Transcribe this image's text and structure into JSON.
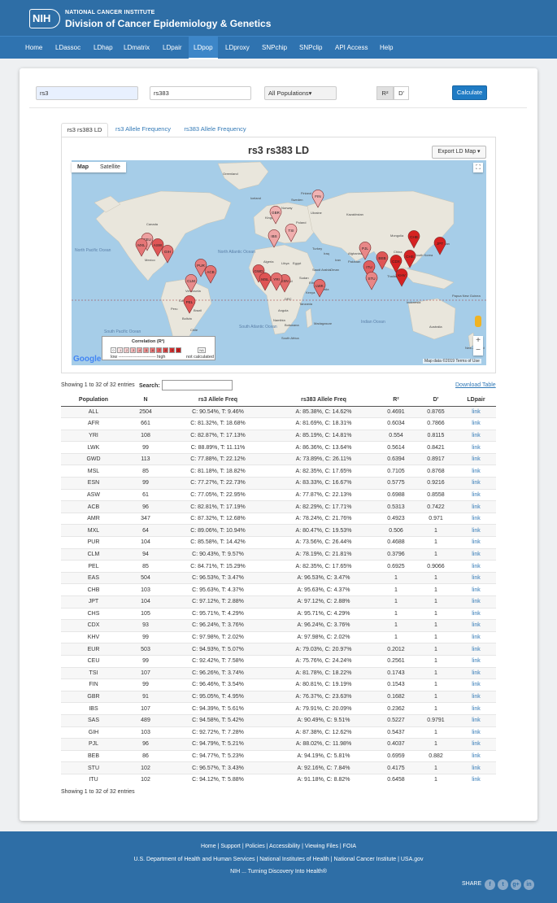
{
  "header": {
    "logo": "NIH",
    "org_line1": "NATIONAL CANCER INSTITUTE",
    "org_line2": "Division of Cancer Epidemiology & Genetics"
  },
  "nav": [
    "Home",
    "LDassoc",
    "LDhap",
    "LDmatrix",
    "LDpair",
    "LDpop",
    "LDproxy",
    "SNPchip",
    "SNPclip",
    "API Access",
    "Help"
  ],
  "form": {
    "snp1": "rs3",
    "snp2": "rs383",
    "population": "All Populations▾",
    "r2": "R²",
    "d": "D'",
    "calculate": "Calculate"
  },
  "tabs": [
    "rs3 rs383 LD",
    "rs3 Allele Frequency",
    "rs383 Allele Frequency"
  ],
  "map": {
    "title": "rs3 rs383 LD",
    "export": "Export LD Map ▾",
    "type_map": "Map",
    "type_satellite": "Satellite",
    "google": "Google",
    "attribution": "Map data ©2019   Terms of Use",
    "legend_title": "Correlation (R²)",
    "legend_low": "low ------------------------- high",
    "legend_na": "NA",
    "legend_nc": "not calculated",
    "legend_cells": [
      "0",
      ".1",
      ".2",
      ".3",
      ".4",
      ".5",
      ".6",
      ".7",
      ".8",
      ".9",
      "1"
    ],
    "place_labels": [
      "Greenland",
      "Iceland",
      "Sweden",
      "Norway",
      "Finland",
      "Ukraine",
      "Kazakhstan",
      "Mongolia",
      "China",
      "South Korea",
      "Japan",
      "Turkey",
      "Iran",
      "Afghanistan",
      "Pakistan",
      "India",
      "Thailand",
      "Egypt",
      "Saudi Arabia",
      "Algeria",
      "Libya",
      "Sudan",
      "Chad",
      "Mali",
      "Niger",
      "DRC",
      "Tanzania",
      "Angola",
      "Namibia",
      "Botswana",
      "Madagascar",
      "South Africa",
      "Indonesia",
      "Papua New Guinea",
      "Australia",
      "New Zealand",
      "Canada",
      "United States",
      "Mexico",
      "Colombia",
      "Peru",
      "Brazil",
      "Bolivia",
      "Chile",
      "Argentina",
      "Venezuela",
      "Poland",
      "Iraq",
      "Kenya",
      "Ethiopia",
      "Somalia",
      "Oman",
      "Kingdom"
    ],
    "ocean_labels": [
      "North Pacific Ocean",
      "North Atlantic Ocean",
      "South Pacific Ocean",
      "South Atlantic Ocean",
      "Indian Ocean"
    ],
    "markers": [
      "FIN",
      "GBR",
      "TSI",
      "IBS",
      "CEU",
      "ASW",
      "MXL",
      "GIH",
      "PUR",
      "ACB",
      "CLM",
      "PEL",
      "GWD",
      "MSL",
      "ESN",
      "YRI",
      "LWK",
      "PJL",
      "BEB",
      "ITU",
      "STU",
      "CDX",
      "CHS",
      "KHV",
      "CHB",
      "JPT"
    ]
  },
  "table": {
    "info": "Showing 1 to 32 of 32 entries",
    "search_label": "Search:",
    "download": "Download Table",
    "columns": [
      "Population",
      "N",
      "rs3 Allele Freq",
      "rs383 Allele Freq",
      "R²",
      "D'",
      "LDpair"
    ],
    "rows": [
      [
        "ALL",
        "2504",
        "C: 90.54%, T: 9.46%",
        "A: 85.38%, C: 14.62%",
        "0.4691",
        "0.8765",
        "link"
      ],
      [
        "AFR",
        "661",
        "C: 81.32%, T: 18.68%",
        "A: 81.69%, C: 18.31%",
        "0.6034",
        "0.7866",
        "link"
      ],
      [
        "YRI",
        "108",
        "C: 82.87%, T: 17.13%",
        "A: 85.19%, C: 14.81%",
        "0.554",
        "0.8115",
        "link"
      ],
      [
        "LWK",
        "99",
        "C: 88.89%, T: 11.11%",
        "A: 86.36%, C: 13.64%",
        "0.5614",
        "0.8421",
        "link"
      ],
      [
        "GWD",
        "113",
        "C: 77.88%, T: 22.12%",
        "A: 73.89%, C: 26.11%",
        "0.6394",
        "0.8917",
        "link"
      ],
      [
        "MSL",
        "85",
        "C: 81.18%, T: 18.82%",
        "A: 82.35%, C: 17.65%",
        "0.7105",
        "0.8768",
        "link"
      ],
      [
        "ESN",
        "99",
        "C: 77.27%, T: 22.73%",
        "A: 83.33%, C: 16.67%",
        "0.5775",
        "0.9216",
        "link"
      ],
      [
        "ASW",
        "61",
        "C: 77.05%, T: 22.95%",
        "A: 77.87%, C: 22.13%",
        "0.6988",
        "0.8558",
        "link"
      ],
      [
        "ACB",
        "96",
        "C: 82.81%, T: 17.19%",
        "A: 82.29%, C: 17.71%",
        "0.5313",
        "0.7422",
        "link"
      ],
      [
        "AMR",
        "347",
        "C: 87.32%, T: 12.68%",
        "A: 78.24%, C: 21.76%",
        "0.4923",
        "0.971",
        "link"
      ],
      [
        "MXL",
        "64",
        "C: 89.06%, T: 10.94%",
        "A: 80.47%, C: 19.53%",
        "0.506",
        "1",
        "link"
      ],
      [
        "PUR",
        "104",
        "C: 85.58%, T: 14.42%",
        "A: 73.56%, C: 26.44%",
        "0.4688",
        "1",
        "link"
      ],
      [
        "CLM",
        "94",
        "C: 90.43%, T: 9.57%",
        "A: 78.19%, C: 21.81%",
        "0.3796",
        "1",
        "link"
      ],
      [
        "PEL",
        "85",
        "C: 84.71%, T: 15.29%",
        "A: 82.35%, C: 17.65%",
        "0.6925",
        "0.9066",
        "link"
      ],
      [
        "EAS",
        "504",
        "C: 96.53%, T: 3.47%",
        "A: 96.53%, C: 3.47%",
        "1",
        "1",
        "link"
      ],
      [
        "CHB",
        "103",
        "C: 95.63%, T: 4.37%",
        "A: 95.63%, C: 4.37%",
        "1",
        "1",
        "link"
      ],
      [
        "JPT",
        "104",
        "C: 97.12%, T: 2.88%",
        "A: 97.12%, C: 2.88%",
        "1",
        "1",
        "link"
      ],
      [
        "CHS",
        "105",
        "C: 95.71%, T: 4.29%",
        "A: 95.71%, C: 4.29%",
        "1",
        "1",
        "link"
      ],
      [
        "CDX",
        "93",
        "C: 96.24%, T: 3.76%",
        "A: 96.24%, C: 3.76%",
        "1",
        "1",
        "link"
      ],
      [
        "KHV",
        "99",
        "C: 97.98%, T: 2.02%",
        "A: 97.98%, C: 2.02%",
        "1",
        "1",
        "link"
      ],
      [
        "EUR",
        "503",
        "C: 94.93%, T: 5.07%",
        "A: 79.03%, C: 20.97%",
        "0.2012",
        "1",
        "link"
      ],
      [
        "CEU",
        "99",
        "C: 92.42%, T: 7.58%",
        "A: 75.76%, C: 24.24%",
        "0.2561",
        "1",
        "link"
      ],
      [
        "TSI",
        "107",
        "C: 96.26%, T: 3.74%",
        "A: 81.78%, C: 18.22%",
        "0.1743",
        "1",
        "link"
      ],
      [
        "FIN",
        "99",
        "C: 96.46%, T: 3.54%",
        "A: 80.81%, C: 19.19%",
        "0.1543",
        "1",
        "link"
      ],
      [
        "GBR",
        "91",
        "C: 95.05%, T: 4.95%",
        "A: 76.37%, C: 23.63%",
        "0.1682",
        "1",
        "link"
      ],
      [
        "IBS",
        "107",
        "C: 94.39%, T: 5.61%",
        "A: 79.91%, C: 20.09%",
        "0.2362",
        "1",
        "link"
      ],
      [
        "SAS",
        "489",
        "C: 94.58%, T: 5.42%",
        "A: 90.49%, C: 9.51%",
        "0.5227",
        "0.9791",
        "link"
      ],
      [
        "GIH",
        "103",
        "C: 92.72%, T: 7.28%",
        "A: 87.38%, C: 12.62%",
        "0.5437",
        "1",
        "link"
      ],
      [
        "PJL",
        "96",
        "C: 94.79%, T: 5.21%",
        "A: 88.02%, C: 11.98%",
        "0.4037",
        "1",
        "link"
      ],
      [
        "BEB",
        "86",
        "C: 94.77%, T: 5.23%",
        "A: 94.19%, C: 5.81%",
        "0.6959",
        "0.882",
        "link"
      ],
      [
        "STU",
        "102",
        "C: 96.57%, T: 3.43%",
        "A: 92.16%, C: 7.84%",
        "0.4175",
        "1",
        "link"
      ],
      [
        "ITU",
        "102",
        "C: 94.12%, T: 5.88%",
        "A: 91.18%, C: 8.82%",
        "0.6458",
        "1",
        "link"
      ]
    ]
  },
  "footer": {
    "line1": "Home   |   Support   |   Policies   |   Accessibility   |   Viewing Files   |   FOIA",
    "line2": "U.S. Department of Health and Human Services   |   National Institutes of Health   |   National Cancer Institute   |   USA.gov",
    "line3": "NIH ... Turning Discovery Into Health®",
    "share": "SHARE",
    "social": [
      "f",
      "t",
      "g+",
      "in"
    ]
  },
  "colors": {
    "header": "#2e6ea6",
    "nav": "#2f73b0",
    "link": "#337ab7",
    "marker_high": "#d92b2b",
    "marker_low": "#f2c2c2"
  }
}
